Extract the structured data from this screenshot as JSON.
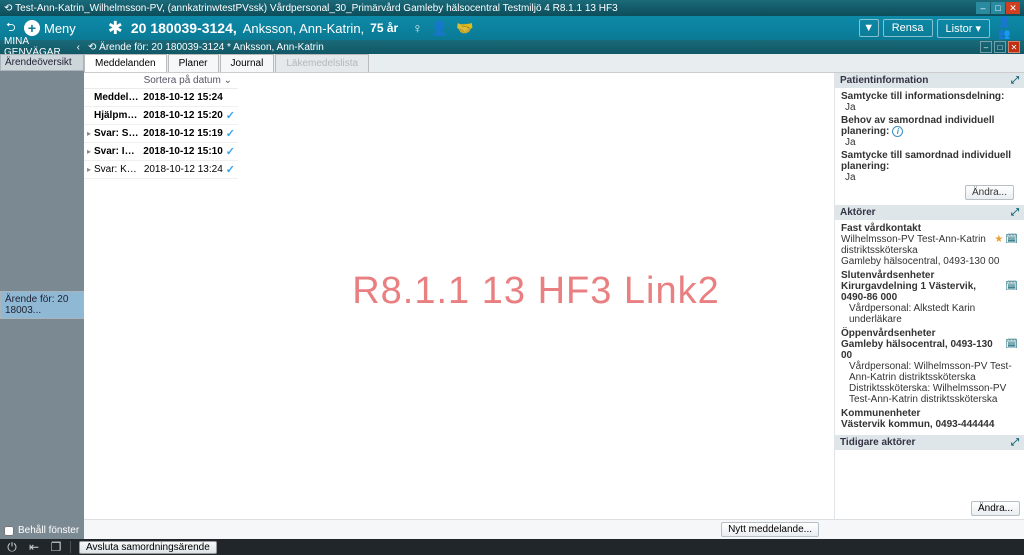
{
  "window": {
    "title": "Test-Ann-Katrin_Wilhelmsson-PV, (annkatrinwtestPVssk) Vårdpersonal_30_Primärvård Gamleby hälsocentral Testmiljö 4 R8.1.1 13 HF3"
  },
  "topbar": {
    "menu_label": "Meny",
    "patient_id": "20 180039-3124,",
    "patient_name": "Anksson, Ann-Katrin,",
    "patient_age": "75 år",
    "rensa_label": "Rensa",
    "listor_label": "Listor ▾"
  },
  "sidehead": {
    "shortcuts": "MINA GENVÄGAR",
    "casefor": "Ärende för: 20 180039-3124 * Anksson, Ann-Katrin"
  },
  "sidebar": {
    "items": [
      "Ärendeöversikt",
      "Ärende för: 20 18003..."
    ],
    "keep_window": "Behåll fönster"
  },
  "tabs": {
    "items": [
      "Meddelanden",
      "Planer",
      "Journal",
      "Läkemedelslista"
    ]
  },
  "msglist": {
    "sort_label": "Sortera på datum ⌄",
    "rows": [
      {
        "subject": "Meddelande om ...",
        "ts": "2018-10-12 15:24",
        "bold": true,
        "arrow": false,
        "check": false
      },
      {
        "subject": "Hjälpmedel",
        "ts": "2018-10-12 15:20",
        "bold": true,
        "arrow": false,
        "check": true
      },
      {
        "subject": "Svar: Status",
        "ts": "2018-10-12 15:19",
        "bold": true,
        "arrow": true,
        "check": true
      },
      {
        "subject": "Svar: Inskrivnings...",
        "ts": "2018-10-12 15:10",
        "bold": true,
        "arrow": true,
        "check": true
      },
      {
        "subject": "Svar: Kallelse till samor...",
        "ts": "2018-10-12 13:24",
        "bold": false,
        "arrow": true,
        "check": true
      }
    ]
  },
  "watermark": "R8.1.1 13 HF3 Link2",
  "rightpanel": {
    "patientinfo": {
      "title": "Patientinformation",
      "consent_label": "Samtycke till informationsdelning:",
      "consent_val": "Ja",
      "needcoord_label": "Behov av samordnad individuell planering:",
      "needcoord_val": "Ja",
      "consentcoord_label": "Samtycke till samordnad individuell planering:",
      "consentcoord_val": "Ja",
      "andra": "Ändra..."
    },
    "aktorer": {
      "title": "Aktörer",
      "fast_label": "Fast vårdkontakt",
      "fast_name": "Wilhelmsson-PV Test-Ann-Katrin distriktssköterska",
      "fast_unit": "Gamleby hälsocentral, 0493-130 00",
      "sluten_label": "Slutenvårdsenheter",
      "sluten_unit": "Kirurgavdelning 1 Västervik, 0490-86 000",
      "sluten_staff": "Vårdpersonal: Alkstedt Karin underläkare",
      "oppen_label": "Öppenvårdsenheter",
      "oppen_unit": "Gamleby hälsocentral, 0493-130 00",
      "oppen_staff1": "Vårdpersonal: Wilhelmsson-PV Test-Ann-Katrin distriktssköterska",
      "oppen_staff2": "Distriktssköterska: Wilhelmsson-PV Test-Ann-Katrin distriktssköterska",
      "kommun_label": "Kommunenheter",
      "kommun_unit": "Västervik kommun, 0493-444444",
      "tidigare_label": "Tidigare aktörer",
      "andra": "Ändra..."
    }
  },
  "footer": {
    "nytt": "Nytt meddelande...",
    "avsluta": "Avsluta samordningsärende"
  }
}
